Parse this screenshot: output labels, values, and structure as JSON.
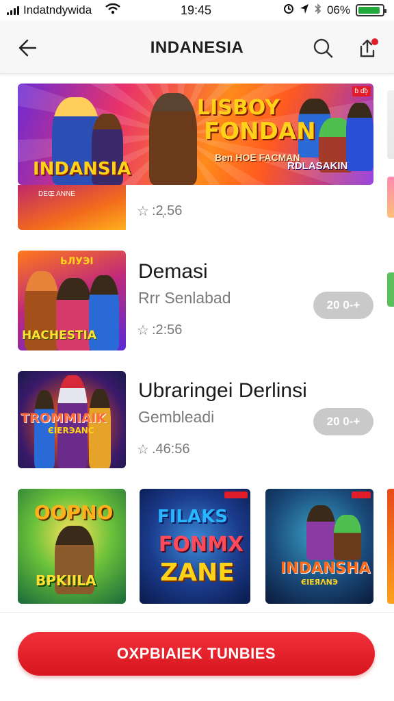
{
  "status_bar": {
    "carrier": "Indatndywida",
    "time": "19:45",
    "battery": "06%",
    "battery_level": 0.9,
    "icons": [
      "signal-icon",
      "wifi-icon",
      "alarm-icon",
      "location-icon",
      "bluetooth-icon",
      "battery-icon"
    ]
  },
  "header": {
    "title": "INDANESIA",
    "icons": [
      "back-arrow-icon",
      "search-icon",
      "share-icon"
    ]
  },
  "featured": {
    "badge": "ɓ ɗɓ̩",
    "title_line1": "LISBOY",
    "title_line2": "FONDAN",
    "subtitle": "Ben HOE FACMAN",
    "left_title": "INDANSIA",
    "left_sub": "DEŒ̩ ANNE",
    "right_title": "RDLASAKIN",
    "rating": ":2̩.56"
  },
  "apps": [
    {
      "name": "Demasi",
      "developer": "Rrr Senlabad",
      "rating": ":2:56",
      "button": "20 0-+",
      "thumb_title": "HACHESTIA",
      "thumb_top": "ЬЛУЭΙ"
    },
    {
      "name": "Ubraringei Derlinsi",
      "developer": "Gembleadi",
      "rating": ".46:56",
      "button": "20 0-+",
      "thumb_title": "TROMMIAIK",
      "thumb_sub": "ЄIERЭANC"
    }
  ],
  "tiles": [
    {
      "line1": "OOPNO",
      "line2": "BPKIILA"
    },
    {
      "line1": "FILAKS",
      "line2": "FONMX",
      "line3": "ZANE"
    },
    {
      "line1": "INDANSHA",
      "line2": "ЄIEЯΛNЭ"
    }
  ],
  "cta": {
    "label": "OXPBIAIEK TUNBIES"
  },
  "colors": {
    "accent_red": "#e11d2a",
    "pill_gray": "#c9c9c9",
    "battery_green": "#22a73b"
  }
}
